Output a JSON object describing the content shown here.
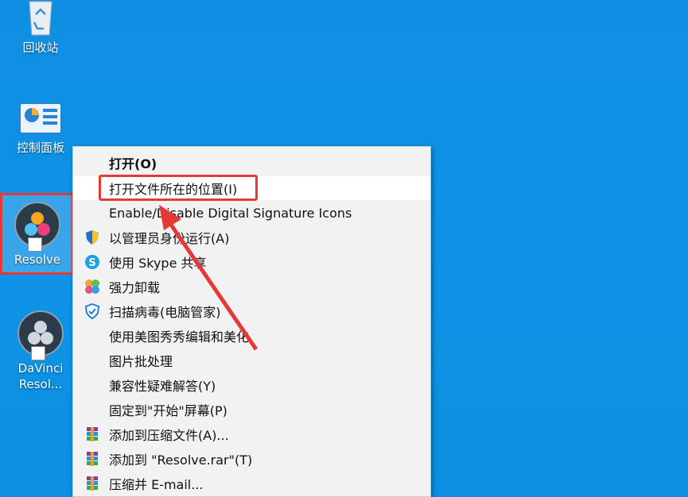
{
  "desktop": {
    "icons": [
      {
        "label": "回收站",
        "icon": "recycle-bin-icon"
      },
      {
        "label": "控制面板",
        "icon": "control-panel-icon"
      },
      {
        "label": "Resolve",
        "icon": "davinci-resolve-icon",
        "selected": true
      },
      {
        "label_line1": "DaVinci",
        "label_line2": "Resol...",
        "icon": "davinci-resolve-icon"
      }
    ]
  },
  "context_menu": {
    "items": [
      {
        "label": "打开(O)",
        "bold": true
      },
      {
        "label": "打开文件所在的位置(I)",
        "highlighted": true
      },
      {
        "label": "Enable/Disable Digital Signature Icons"
      },
      {
        "label": "以管理员身份运行(A)",
        "icon": "shield-icon"
      },
      {
        "label": "使用 Skype 共享",
        "icon": "skype-icon"
      },
      {
        "label": "强力卸载",
        "icon": "uninstall-icon"
      },
      {
        "label": "扫描病毒(电脑管家)",
        "icon": "tencent-guard-icon"
      },
      {
        "label": "使用美图秀秀编辑和美化"
      },
      {
        "label": "图片批处理"
      },
      {
        "label": "兼容性疑难解答(Y)"
      },
      {
        "label": "固定到\"开始\"屏幕(P)"
      },
      {
        "label": "添加到压缩文件(A)...",
        "icon": "winrar-icon"
      },
      {
        "label": "添加到 \"Resolve.rar\"(T)",
        "icon": "winrar-icon"
      },
      {
        "label": "压缩并 E-mail...",
        "icon": "winrar-icon"
      }
    ]
  },
  "colors": {
    "desktop": "#0f8fe3",
    "annotation": "#e53935"
  }
}
